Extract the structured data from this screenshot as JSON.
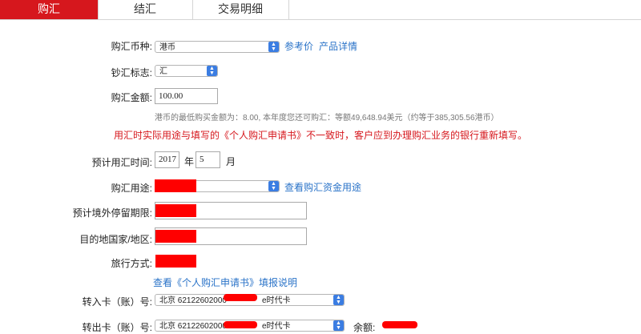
{
  "tabs": [
    {
      "label": "购汇",
      "active": true
    },
    {
      "label": "结汇",
      "active": false
    },
    {
      "label": "交易明细",
      "active": false
    }
  ],
  "form": {
    "currency": {
      "label": "购汇币种:",
      "value": "港币",
      "link1": "参考价",
      "link2": "产品详情"
    },
    "cash_flag": {
      "label": "钞汇标志:",
      "value": "汇"
    },
    "amount": {
      "label": "购汇金额:",
      "value": "100.00",
      "hint": "港币的最低购买金额为：8.00, 本年度您还可购汇：等额49,648.94美元（约等于385,305.56港币）"
    },
    "warning": "用汇时实际用途与填写的《个人购汇申请书》不一致时，客户应到办理购汇业务的银行重新填写。",
    "time": {
      "label": "预计用汇时间:",
      "year": "2017",
      "year_unit": "年",
      "month": "5",
      "month_unit": "月"
    },
    "purpose": {
      "label": "购汇用途:",
      "link": "查看购汇资金用途"
    },
    "stay": {
      "label": "预计境外停留期限:"
    },
    "destination": {
      "label": "目的地国家/地区:"
    },
    "travel": {
      "label": "旅行方式:"
    },
    "application_link": "查看《个人购汇申请书》填报说明",
    "in_card": {
      "label": "转入卡（账）号:",
      "prefix": "北京 62122602000",
      "suffix": "e时代卡"
    },
    "out_card": {
      "label": "转出卡（账）号:",
      "prefix": "北京 62122602000",
      "suffix": "e时代卡",
      "balance_label": "余额:"
    }
  },
  "colors": {
    "accent": "#d6171d",
    "link": "#2a73c8",
    "redaction": "#ff0000"
  }
}
